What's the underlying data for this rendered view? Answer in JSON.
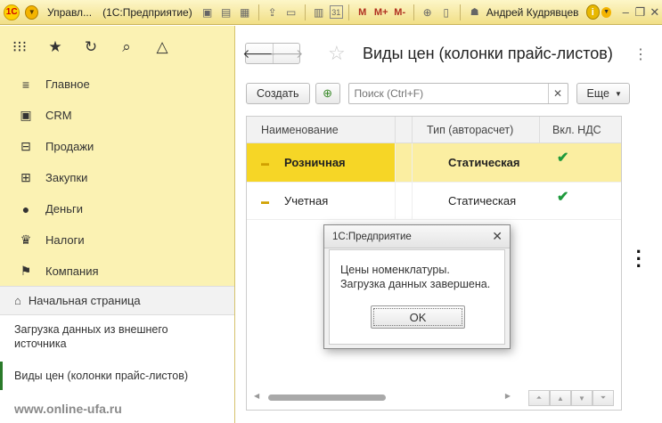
{
  "window": {
    "app_short_title": "Управл...",
    "app_name": "(1С:Предприятие)",
    "user": "Андрей Кудрявцев",
    "toolbar_memory": [
      "M",
      "M+",
      "M-"
    ],
    "calendar_day": "31",
    "logo": "1С"
  },
  "sidebar": {
    "top_icons": [
      "apps-grid-icon",
      "star-icon",
      "history-icon",
      "search-icon",
      "bell-icon"
    ],
    "items": [
      {
        "label": "Главное",
        "icon": "menu-lines-icon"
      },
      {
        "label": "CRM",
        "icon": "id-card-icon"
      },
      {
        "label": "Продажи",
        "icon": "basket-icon"
      },
      {
        "label": "Закупки",
        "icon": "cart-icon"
      },
      {
        "label": "Деньги",
        "icon": "ruble-coin-icon"
      },
      {
        "label": "Налоги",
        "icon": "eagle-icon"
      },
      {
        "label": "Компания",
        "icon": "flag-icon"
      }
    ],
    "home": "Начальная страница",
    "open_windows": [
      "Загрузка данных из внешнего источника",
      "Виды цен (колонки прайс-листов)"
    ],
    "watermark": "www.online-ufa.ru"
  },
  "main": {
    "title": "Виды цен (колонки прайс-листов)",
    "create_button": "Создать",
    "search_placeholder": "Поиск (Ctrl+F)",
    "more_button": "Еще",
    "columns": {
      "name": "Наименование",
      "type": "Тип (авторасчет)",
      "vat": "Вкл. НДС"
    },
    "rows": [
      {
        "name": "Розничная",
        "type": "Статическая",
        "vat": "✔",
        "selected": true
      },
      {
        "name": "Учетная",
        "type": "Статическая",
        "vat": "✔",
        "selected": false
      }
    ]
  },
  "dialog": {
    "title": "1С:Предприятие",
    "line1": "Цены номенклатуры.",
    "line2": "Загрузка данных завершена.",
    "ok": "OK"
  },
  "colors": {
    "accent_yellow": "#f6d626",
    "selected_row": "#fbeea1",
    "sidebar_bg": "#fbf2b3",
    "check_green": "#1f9a3c"
  }
}
